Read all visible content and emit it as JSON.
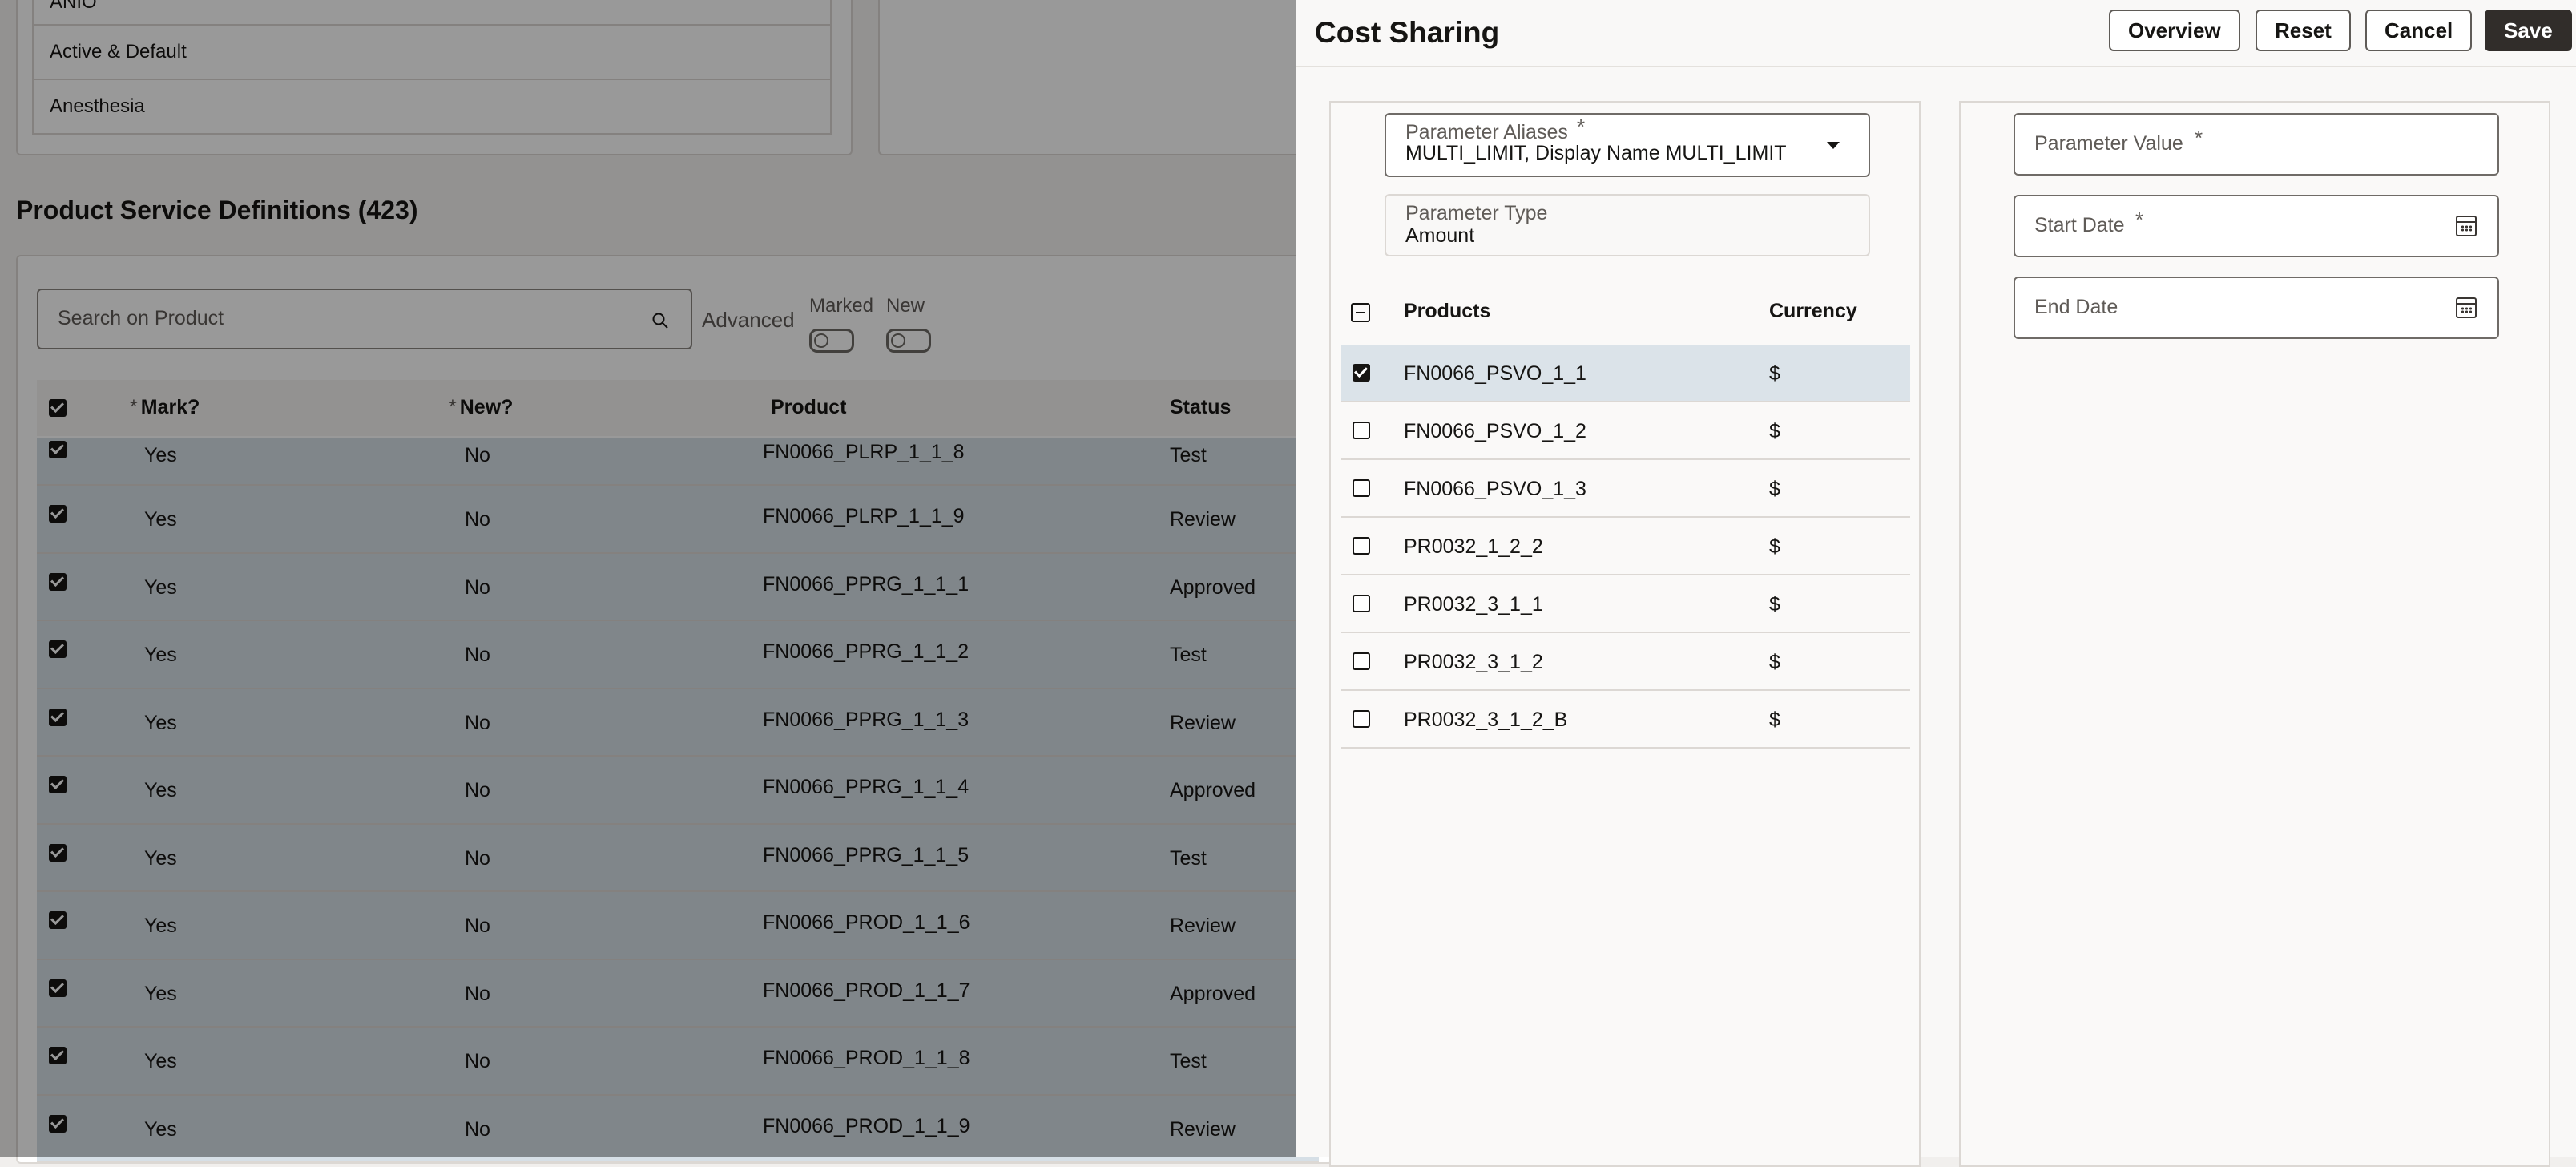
{
  "background": {
    "top_list": [
      "ANIO",
      "Active & Default",
      "Anesthesia"
    ],
    "section_title": "Product Service Definitions (423)",
    "search_placeholder": "Search on Product",
    "advanced_label": "Advanced",
    "toggle_marked": "Marked",
    "toggle_new": "New",
    "columns": [
      "Mark?",
      "New?",
      "Product",
      "Status"
    ],
    "rows": [
      {
        "mark": "Yes",
        "new": "No",
        "product": "FN0066_PLRP_1_1_8",
        "status": "Test"
      },
      {
        "mark": "Yes",
        "new": "No",
        "product": "FN0066_PLRP_1_1_9",
        "status": "Review"
      },
      {
        "mark": "Yes",
        "new": "No",
        "product": "FN0066_PPRG_1_1_1",
        "status": "Approved"
      },
      {
        "mark": "Yes",
        "new": "No",
        "product": "FN0066_PPRG_1_1_2",
        "status": "Test"
      },
      {
        "mark": "Yes",
        "new": "No",
        "product": "FN0066_PPRG_1_1_3",
        "status": "Review"
      },
      {
        "mark": "Yes",
        "new": "No",
        "product": "FN0066_PPRG_1_1_4",
        "status": "Approved"
      },
      {
        "mark": "Yes",
        "new": "No",
        "product": "FN0066_PPRG_1_1_5",
        "status": "Test"
      },
      {
        "mark": "Yes",
        "new": "No",
        "product": "FN0066_PROD_1_1_6",
        "status": "Review"
      },
      {
        "mark": "Yes",
        "new": "No",
        "product": "FN0066_PROD_1_1_7",
        "status": "Approved"
      },
      {
        "mark": "Yes",
        "new": "No",
        "product": "FN0066_PROD_1_1_8",
        "status": "Test"
      },
      {
        "mark": "Yes",
        "new": "No",
        "product": "FN0066_PROD_1_1_9",
        "status": "Review"
      }
    ]
  },
  "drawer": {
    "title": "Cost Sharing",
    "buttons": {
      "overview": "Overview",
      "reset": "Reset",
      "cancel": "Cancel",
      "save": "Save"
    },
    "parameter_aliases": {
      "label": "Parameter Aliases",
      "value": "MULTI_LIMIT, Display Name MULTI_LIMIT"
    },
    "parameter_type": {
      "label": "Parameter Type",
      "value": "Amount"
    },
    "products_header": "Products",
    "currency_header": "Currency",
    "products": [
      {
        "name": "FN0066_PSVO_1_1",
        "currency": "$",
        "checked": true
      },
      {
        "name": "FN0066_PSVO_1_2",
        "currency": "$",
        "checked": false
      },
      {
        "name": "FN0066_PSVO_1_3",
        "currency": "$",
        "checked": false
      },
      {
        "name": "PR0032_1_2_2",
        "currency": "$",
        "checked": false
      },
      {
        "name": "PR0032_3_1_1",
        "currency": "$",
        "checked": false
      },
      {
        "name": "PR0032_3_1_2",
        "currency": "$",
        "checked": false
      },
      {
        "name": "PR0032_3_1_2_B",
        "currency": "$",
        "checked": false
      }
    ],
    "parameter_value": {
      "label": "Parameter Value"
    },
    "start_date": {
      "label": "Start Date"
    },
    "end_date": {
      "label": "End Date"
    }
  }
}
